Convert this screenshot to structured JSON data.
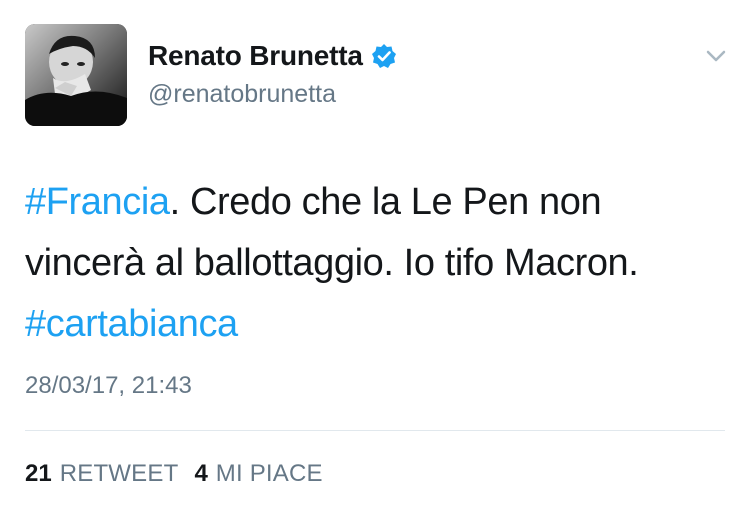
{
  "tweet": {
    "display_name": "Renato Brunetta",
    "handle": "@renatobrunetta",
    "verified": true,
    "text_segments": [
      {
        "text": "#Francia",
        "hashtag": true
      },
      {
        "text": ". Credo che la Le Pen non vincerà al ballottaggio. Io tifo Macron. ",
        "hashtag": false
      },
      {
        "text": "#cartabianca",
        "hashtag": true
      }
    ],
    "timestamp": "28/03/17, 21:43",
    "stats": {
      "retweets_count": "21",
      "retweets_label": "RETWEET",
      "likes_count": "4",
      "likes_label": "MI PIACE"
    }
  },
  "colors": {
    "link": "#1da1f2",
    "secondary": "#657786",
    "text": "#14171a",
    "divider": "#e1e8ed"
  },
  "icons": {
    "verified": "verified-badge-icon",
    "menu": "chevron-down-icon"
  }
}
